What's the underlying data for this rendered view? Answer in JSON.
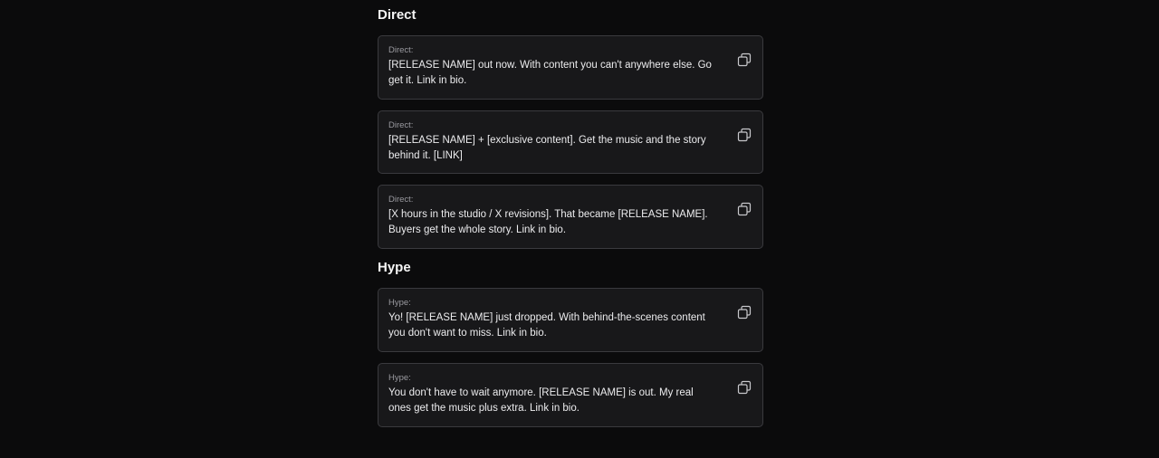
{
  "sections": [
    {
      "title": "Direct",
      "cards": [
        {
          "label": "Direct:",
          "text": "[RELEASE NAME] out now. With content you can't anywhere else. Go get it. Link in bio."
        },
        {
          "label": "Direct:",
          "text": "[RELEASE NAME] + [exclusive content]. Get the music and the story behind it. [LINK]"
        },
        {
          "label": "Direct:",
          "text": "[X hours in the studio / X revisions]. That became [RELEASE NAME]. Buyers get the whole story. Link in bio."
        }
      ]
    },
    {
      "title": "Hype",
      "cards": [
        {
          "label": "Hype:",
          "text": "Yo! [RELEASE NAME] just dropped. With behind-the-scenes content you don't want to miss. Link in bio."
        },
        {
          "label": "Hype:",
          "text": "You don't have to wait anymore. [RELEASE NAME] is out. My real ones get the music plus extra. Link in bio."
        }
      ]
    }
  ],
  "icons": {
    "copy": "copy-icon"
  },
  "colors": {
    "background": "#0b0b0c",
    "card": "#18181a",
    "border": "#3a3a3e"
  }
}
